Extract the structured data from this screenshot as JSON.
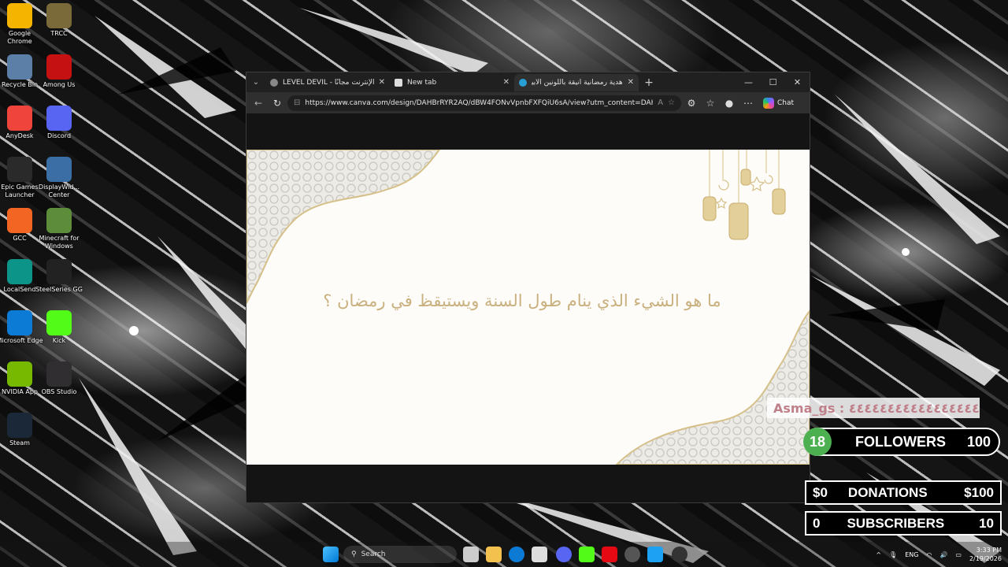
{
  "desktop_icons": [
    {
      "label": "Google Chrome",
      "color": "#f4b400"
    },
    {
      "label": "TRCC",
      "color": "#7a6a3a"
    },
    {
      "label": "Recycle Bin",
      "color": "#5c7fa8"
    },
    {
      "label": "Among Us",
      "color": "#c51111"
    },
    {
      "label": "AnyDesk",
      "color": "#ef443b"
    },
    {
      "label": "Discord",
      "color": "#5865f2"
    },
    {
      "label": "Epic Games Launcher",
      "color": "#2a2a2a"
    },
    {
      "label": "DisplayWid... Center",
      "color": "#3a6ea5"
    },
    {
      "label": "GCC",
      "color": "#f26522"
    },
    {
      "label": "Minecraft for Windows",
      "color": "#5d8c3a"
    },
    {
      "label": "LocalSend",
      "color": "#0d9488"
    },
    {
      "label": "SteelSeries GG",
      "color": "#222222"
    },
    {
      "label": "Microsoft Edge",
      "color": "#0c7bd6"
    },
    {
      "label": "Kick",
      "color": "#53fc18"
    },
    {
      "label": "NVIDIA App",
      "color": "#76b900"
    },
    {
      "label": "OBS Studio",
      "color": "#302e31"
    },
    {
      "label": "Steam",
      "color": "#1b2838"
    }
  ],
  "browser": {
    "tabs": [
      {
        "title": "LEVEL DEVIL - ب على الإنترنت مجانًا",
        "active": false
      },
      {
        "title": "New tab",
        "active": false
      },
      {
        "title": "هدية رمضانية أنيقة باللونين الأبيض",
        "active": true
      }
    ],
    "new_tab_label": "+",
    "url": "https://www.canva.com/design/DAHBrRYR2AQ/dBW4FONvVpnbFXFQiU6sA/view?utm_content=DAHBrRYR...",
    "chat_label": "Chat"
  },
  "slide": {
    "question": "ما هو الشيء الذي ينام طول السنة ويستيقظ في رمضان ؟"
  },
  "overlay": {
    "chat_message": "Asma_gs : ٤٤٤٤٤٤٤٤٤٤٤٤٤٤٤٤٤٤٤٤",
    "followers": {
      "current": "18",
      "label": "FOLLOWERS",
      "goal": "100",
      "color": "#4caf50"
    },
    "donations": {
      "current": "$0",
      "label": "DONATIONS",
      "goal": "$100"
    },
    "subscribers": {
      "current": "0",
      "label": "SUBSCRIBERS",
      "goal": "10"
    }
  },
  "taskbar": {
    "search_placeholder": "Search",
    "language": "ENG",
    "time": "3:33 PM",
    "date": "2/19/2026"
  }
}
